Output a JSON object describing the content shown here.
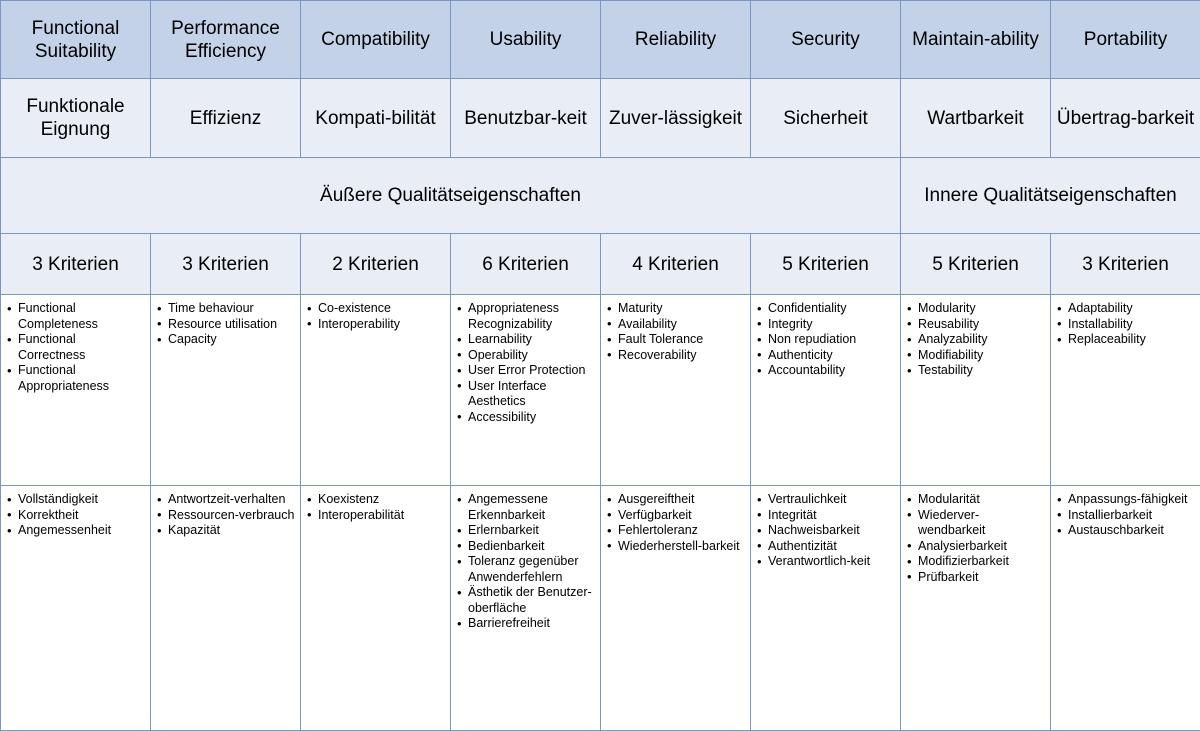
{
  "theme": {
    "header_bg": "#c3d2e8",
    "light_bg": "#e9edf6",
    "cell_bg": "#ffffff",
    "border": "#7b96bf",
    "text": "#000000"
  },
  "table": {
    "columns": [
      {
        "name_en": "Functional Suitability",
        "name_de": "Funktionale Eignung",
        "group": "outer",
        "count_label": "3 Kriterien",
        "criteria_en": [
          "Functional Completeness",
          "Functional Correctness",
          "Functional Appropriateness"
        ],
        "criteria_de": [
          "Vollständigkeit",
          "Korrektheit",
          "Angemessenheit"
        ]
      },
      {
        "name_en": "Performance Efficiency",
        "name_de": "Effizienz",
        "group": "outer",
        "count_label": "3 Kriterien",
        "criteria_en": [
          "Time behaviour",
          "Resource utilisation",
          "Capacity"
        ],
        "criteria_de": [
          "Antwortzeit-verhalten",
          "Ressourcen-verbrauch",
          "Kapazität"
        ]
      },
      {
        "name_en": "Compatibility",
        "name_de": "Kompati-bilität",
        "group": "outer",
        "count_label": "2 Kriterien",
        "criteria_en": [
          "Co-existence",
          "Interoperability"
        ],
        "criteria_de": [
          "Koexistenz",
          "Interoperabilität"
        ]
      },
      {
        "name_en": "Usability",
        "name_de": "Benutzbar-keit",
        "group": "outer",
        "count_label": "6 Kriterien",
        "criteria_en": [
          "Appropriateness Recognizability",
          "Learnability",
          "Operability",
          "User Error Protection",
          "User Interface Aesthetics",
          "Accessibility"
        ],
        "criteria_de": [
          "Angemessene Erkennbarkeit",
          "Erlernbarkeit",
          "Bedienbarkeit",
          "Toleranz gegenüber Anwenderfehlern",
          "Ästhetik der Benutzer-oberfläche",
          "Barrierefreiheit"
        ]
      },
      {
        "name_en": "Reliability",
        "name_de": "Zuver-lässigkeit",
        "group": "outer",
        "count_label": "4 Kriterien",
        "criteria_en": [
          "Maturity",
          "Availability",
          "Fault Tolerance",
          "Recoverability"
        ],
        "criteria_de": [
          "Ausgereiftheit",
          "Verfügbarkeit",
          "Fehlertoleranz",
          "Wiederherstell-barkeit"
        ]
      },
      {
        "name_en": "Security",
        "name_de": "Sicherheit",
        "group": "outer",
        "count_label": "5 Kriterien",
        "criteria_en": [
          "Confidentiality",
          "Integrity",
          "Non repudiation",
          "Authenticity",
          "Accountability"
        ],
        "criteria_de": [
          "Vertraulichkeit",
          "Integrität",
          "Nachweisbarkeit",
          "Authentizität",
          "Verantwortlich-keit"
        ]
      },
      {
        "name_en": "Maintain-ability",
        "name_de": "Wartbarkeit",
        "group": "inner",
        "count_label": "5 Kriterien",
        "criteria_en": [
          "Modularity",
          "Reusability",
          "Analyzability",
          "Modifiability",
          "Testability"
        ],
        "criteria_de": [
          "Modularität",
          "Wiederver-wendbarkeit",
          "Analysierbarkeit",
          "Modifizierbarkeit",
          "Prüfbarkeit"
        ]
      },
      {
        "name_en": "Portability",
        "name_de": "Übertrag-barkeit",
        "group": "inner",
        "count_label": "3 Kriterien",
        "criteria_en": [
          "Adaptability",
          "Installability",
          "Replaceability"
        ],
        "criteria_de": [
          "Anpassungs-fähigkeit",
          "Installierbarkeit",
          "Austauschbarkeit"
        ]
      }
    ],
    "groups": [
      {
        "label": "Äußere Qualitätseigenschaften",
        "span": 6
      },
      {
        "label": "Innere Qualitätseigenschaften",
        "span": 2
      }
    ]
  }
}
